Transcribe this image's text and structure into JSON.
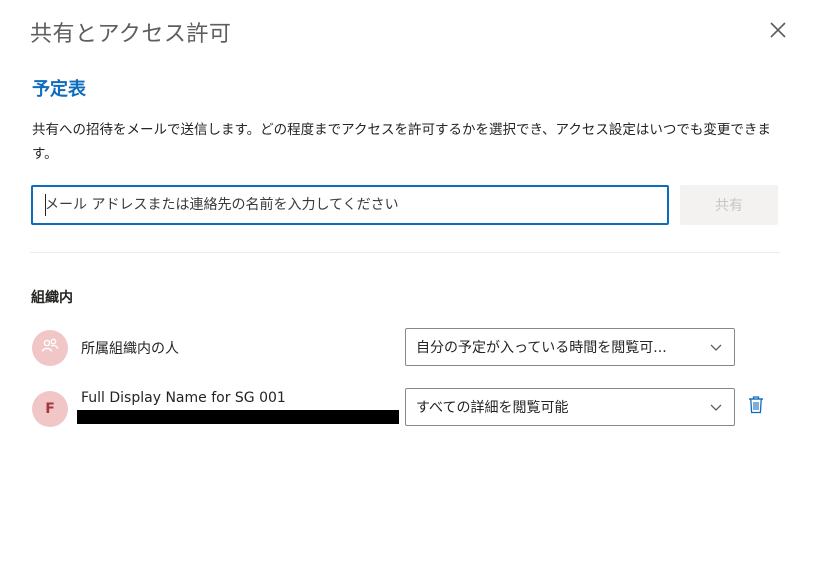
{
  "dialog": {
    "title": "共有とアクセス許可"
  },
  "calendar": {
    "name": "予定表"
  },
  "description": "共有への招待をメールで送信します。どの程度までアクセスを許可するかを選択でき、アクセス設定はいつでも変更できます。",
  "invite": {
    "placeholder": "メール アドレスまたは連絡先の名前を入力してください",
    "share_label": "共有"
  },
  "section": {
    "header": "組織内"
  },
  "members": [
    {
      "name": "所属組織内の人",
      "icon": "people-icon",
      "permission": "自分の予定が入っている時間を閲覧可..."
    },
    {
      "name": "Full Display Name for SG 001",
      "initial": "F",
      "permission": "すべての詳細を閲覧可能"
    }
  ],
  "colors": {
    "accent": "#0f6cbd",
    "avatar_bg": "#f1c6c7",
    "avatar_fg": "#a4373a",
    "disabled_button_bg": "#f3f2f1"
  }
}
